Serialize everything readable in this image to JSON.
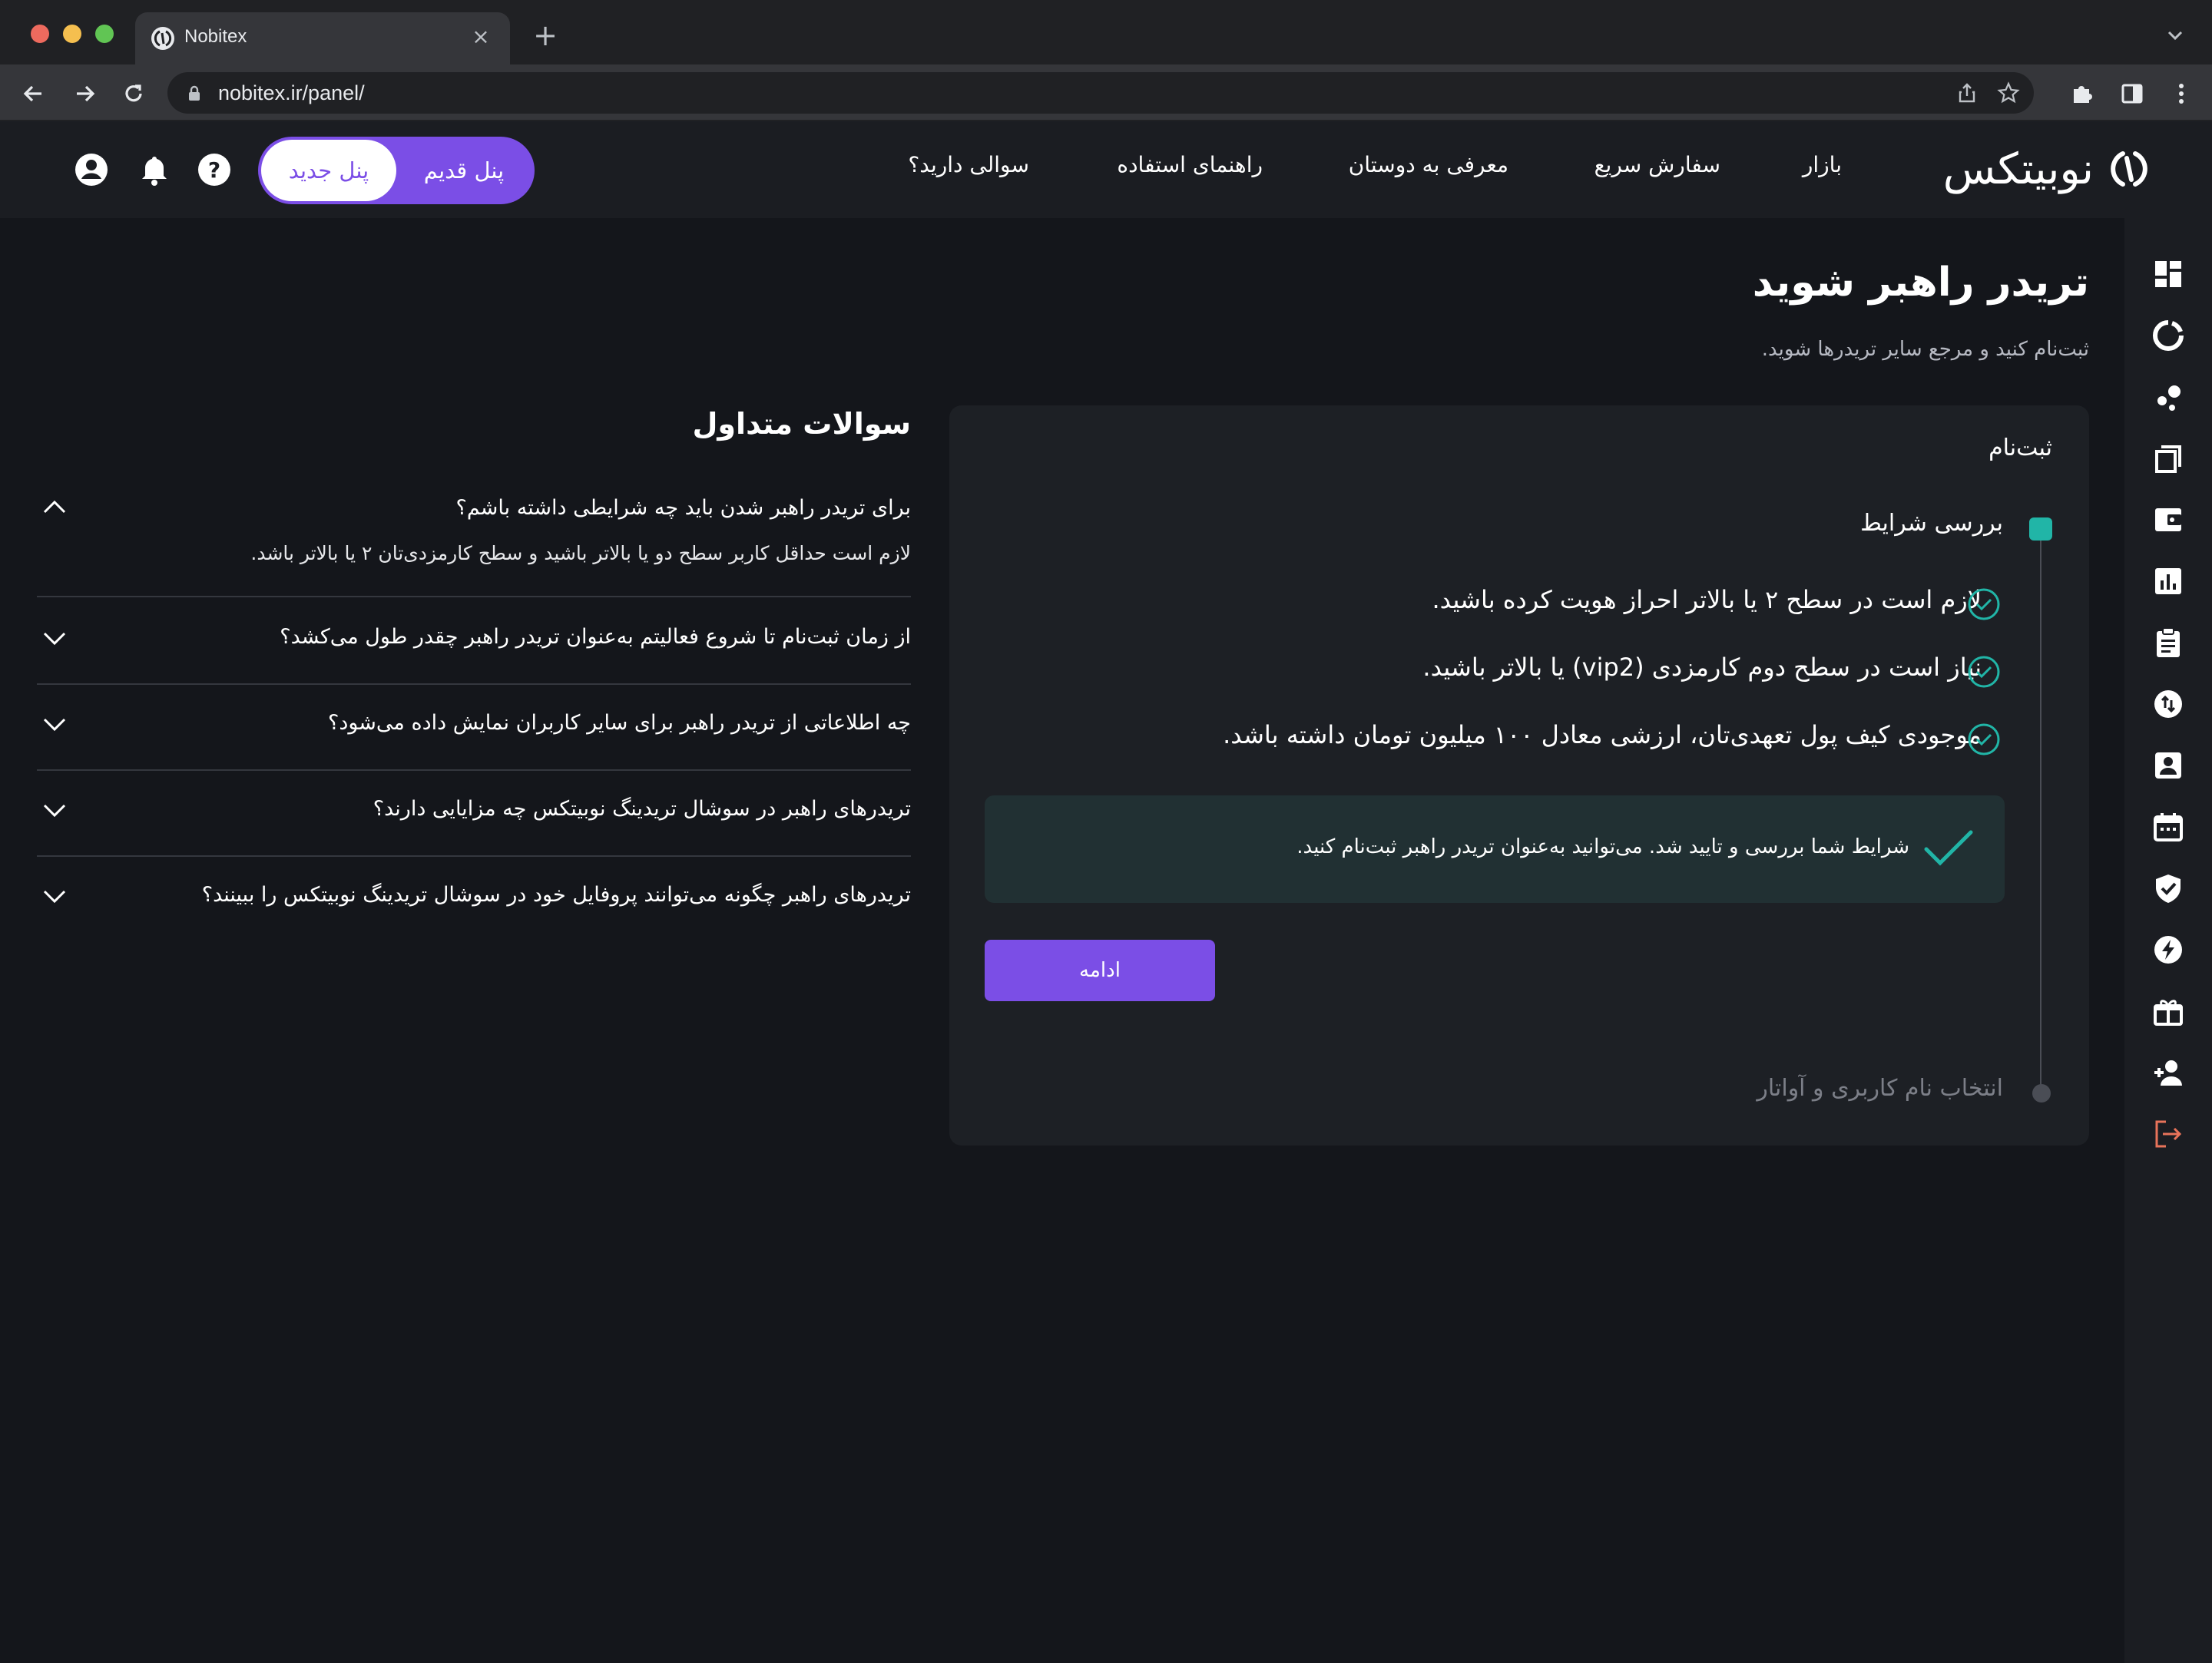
{
  "browser": {
    "tab_title": "Nobitex",
    "url": "nobitex.ir/panel/",
    "traffic_colors": [
      "#ed6a5e",
      "#f5bf4f",
      "#61c554"
    ]
  },
  "header": {
    "logo_text": "نوبیتکس",
    "nav": [
      "بازار",
      "سفارش سریع",
      "معرفی به دوستان",
      "راهنمای استفاده",
      "سوالی دارید؟"
    ],
    "panel_old": "پنل قدیم",
    "panel_new": "پنل جدید",
    "icons": [
      "help-icon",
      "bell-icon",
      "user-account-icon"
    ]
  },
  "sidebar": {
    "icons": [
      "dashboard-icon",
      "market-icon",
      "social-trading-icon",
      "orders-icon",
      "wallet-icon",
      "chart-icon",
      "report-icon",
      "transfer-icon",
      "profile-icon",
      "calendar-icon",
      "security-icon",
      "quick-order-icon",
      "gift-icon",
      "invite-friend-icon",
      "logout-icon"
    ]
  },
  "page": {
    "title": "تریدر راهبر شوید",
    "subtitle": "ثبت‌نام کنید و مرجع سایر تریدرها شوید."
  },
  "registration": {
    "heading": "ثبت‌نام",
    "step1_label": "بررسی شرایط",
    "conditions": [
      "لازم است در سطح ۲ یا بالاتر احراز هویت کرده باشید.",
      "نیاز است در سطح دوم کارمزدی (vip2) یا بالاتر باشید.",
      "موجودی کیف پول تعهدی‌تان، ارزشی معادل ۱۰۰ میلیون تومان داشته باشد."
    ],
    "success_message": "شرایط شما بررسی و تایید شد. می‌توانید به‌عنوان تریدر راهبر ثبت‌نام کنید.",
    "continue_label": "ادامه",
    "step2_label": "انتخاب نام کاربری و آواتار",
    "accent": "#7b4ee6",
    "success_color": "#21b5a7"
  },
  "faq": {
    "title": "سوالات متداول",
    "items": [
      {
        "question": "برای تریدر راهبر شدن باید چه شرایطی داشته باشم؟",
        "answer": "لازم است حداقل کاربر سطح دو یا بالاتر باشید و سطح کارمزدی‌تان ۲ یا بالاتر باشد.",
        "expanded": true
      },
      {
        "question": "از زمان ثبت‌نام تا شروع فعالیتم به‌عنوان تریدر راهبر چقدر طول می‌کشد؟",
        "expanded": false
      },
      {
        "question": "چه اطلاعاتی از تریدر راهبر برای سایر کاربران نمایش داده می‌شود؟",
        "expanded": false
      },
      {
        "question": "تریدرهای راهبر در سوشال تریدینگ نوبیتکس چه مزایایی دارند؟",
        "expanded": false
      },
      {
        "question": "تریدرهای راهبر چگونه می‌توانند پروفایل خود در سوشال تریدینگ نوبیتکس را ببینند؟",
        "expanded": false
      }
    ]
  }
}
